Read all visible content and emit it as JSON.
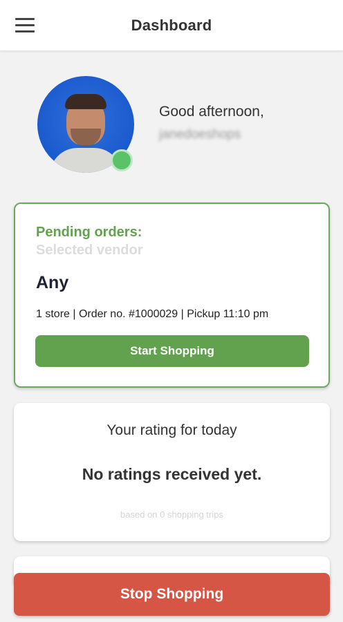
{
  "header": {
    "title": "Dashboard",
    "menu_icon": "hamburger-menu-icon"
  },
  "profile": {
    "greeting": "Good afternoon,",
    "username": "janedoeshops",
    "status_color": "#5bc26a"
  },
  "pending_orders": {
    "title": "Pending orders:",
    "subtitle": "Selected vendor",
    "vendor": "Any",
    "meta": "1 store | Order no. #1000029 | Pickup 11:10 pm",
    "start_button": "Start Shopping",
    "accent_color": "#62a24f"
  },
  "rating": {
    "title": "Your rating for today",
    "value": "No ratings received yet.",
    "note": "based on 0 shopping trips"
  },
  "footer": {
    "stop_button": "Stop Shopping",
    "stop_color": "#d55645"
  }
}
